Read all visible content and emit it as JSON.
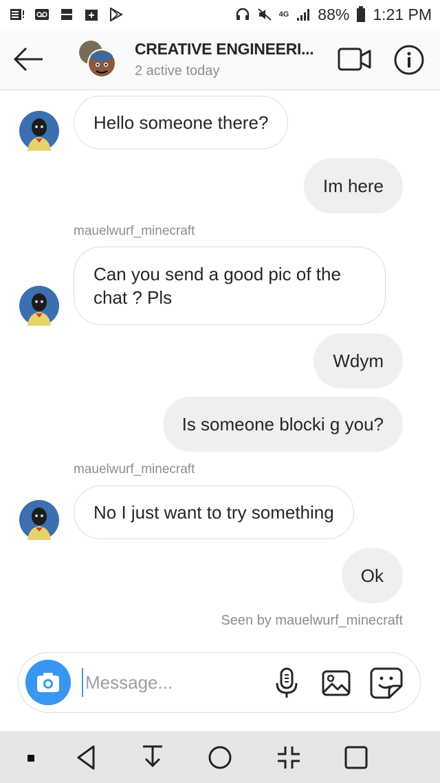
{
  "status_bar": {
    "battery": "88%",
    "time": "1:21 PM",
    "network": "4G"
  },
  "header": {
    "title": "CREATIVE ENGINEERI...",
    "subtitle": "2 active today",
    "icons": [
      "back-arrow-icon",
      "video-call-icon",
      "info-icon"
    ]
  },
  "messages": [
    {
      "direction": "in",
      "text": "Hello someone there?"
    },
    {
      "direction": "out",
      "text": "Im here"
    },
    {
      "direction": "in",
      "sender": "mauelwurf_minecraft",
      "line1": "Can you send a good pic of the",
      "line2": "chat ? Pls"
    },
    {
      "direction": "out",
      "text": "Wdym"
    },
    {
      "direction": "out",
      "text": "Is someone blocki g you?"
    },
    {
      "direction": "in",
      "sender": "mauelwurf_minecraft",
      "text": "No I just want to try something"
    },
    {
      "direction": "out",
      "text": "Ok"
    }
  ],
  "seen_text": "Seen by mauelwurf_minecraft",
  "composer": {
    "placeholder": "Message...",
    "icons": [
      "camera-icon",
      "microphone-icon",
      "gallery-icon",
      "sticker-icon"
    ]
  },
  "colors": {
    "accent": "#3897f0",
    "outgoing_bubble": "#efefef",
    "secondary_text": "#8e8e8e"
  }
}
